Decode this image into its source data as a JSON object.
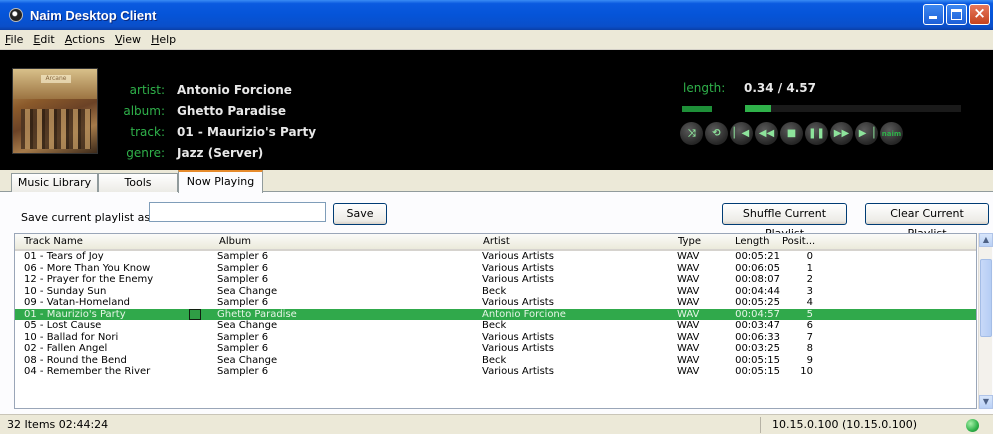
{
  "window": {
    "title": "Naim Desktop Client"
  },
  "menu": [
    "File",
    "Edit",
    "Actions",
    "View",
    "Help"
  ],
  "player": {
    "artist_label": "artist:",
    "artist": "Antonio Forcione",
    "album_label": "album:",
    "album": "Ghetto Paradise",
    "track_label": "track:",
    "track": "01 - Maurizio's Party",
    "genre_label": "genre:",
    "genre": "Jazz (Server)",
    "length_label": "length:",
    "length": "0.34 / 4.57",
    "progress_fraction": 0.12,
    "cover_text": "Arcane",
    "naim_logo": "naim"
  },
  "tabs": [
    "Music Library",
    "Tools",
    "Now Playing"
  ],
  "playlist": {
    "save_label": "Save current playlist as:",
    "save_value": "",
    "save_button": "Save",
    "shuffle_button": "Shuffle Current Playlist",
    "clear_button": "Clear Current Playlist"
  },
  "table": {
    "columns": [
      "Track Name",
      "Album",
      "Artist",
      "Type",
      "Length",
      "Posit..."
    ],
    "rows": [
      [
        "01 - Tears of Joy",
        "Sampler 6",
        "Various Artists",
        "WAV",
        "00:05:21",
        "0"
      ],
      [
        "06 - More Than You Know",
        "Sampler 6",
        "Various Artists",
        "WAV",
        "00:06:05",
        "1"
      ],
      [
        "12 - Prayer for the Enemy",
        "Sampler 6",
        "Various Artists",
        "WAV",
        "00:08:07",
        "2"
      ],
      [
        "10 - Sunday Sun",
        "Sea Change",
        "Beck",
        "WAV",
        "00:04:44",
        "3"
      ],
      [
        "09 - Vatan-Homeland",
        "Sampler 6",
        "Various Artists",
        "WAV",
        "00:05:25",
        "4"
      ],
      [
        "01 - Maurizio's Party",
        "Ghetto Paradise",
        "Antonio Forcione",
        "WAV",
        "00:04:57",
        "5"
      ],
      [
        "05 - Lost Cause",
        "Sea Change",
        "Beck",
        "WAV",
        "00:03:47",
        "6"
      ],
      [
        "10 - Ballad for Nori",
        "Sampler 6",
        "Various Artists",
        "WAV",
        "00:06:33",
        "7"
      ],
      [
        "02 - Fallen Angel",
        "Sampler 6",
        "Various Artists",
        "WAV",
        "00:03:25",
        "8"
      ],
      [
        "08 - Round the Bend",
        "Sea Change",
        "Beck",
        "WAV",
        "00:05:15",
        "9"
      ],
      [
        "04 - Remember the River",
        "Sampler 6",
        "Various Artists",
        "WAV",
        "00:05:15",
        "10"
      ]
    ],
    "selected_index": 5
  },
  "status": {
    "left": "32 Items  02:44:24",
    "right": "10.15.0.100 (10.15.0.100)"
  },
  "colors": {
    "accent_green": "#2fb14a",
    "titlebar_blue": "#0554d8",
    "tab_highlight": "#e68b2c"
  }
}
